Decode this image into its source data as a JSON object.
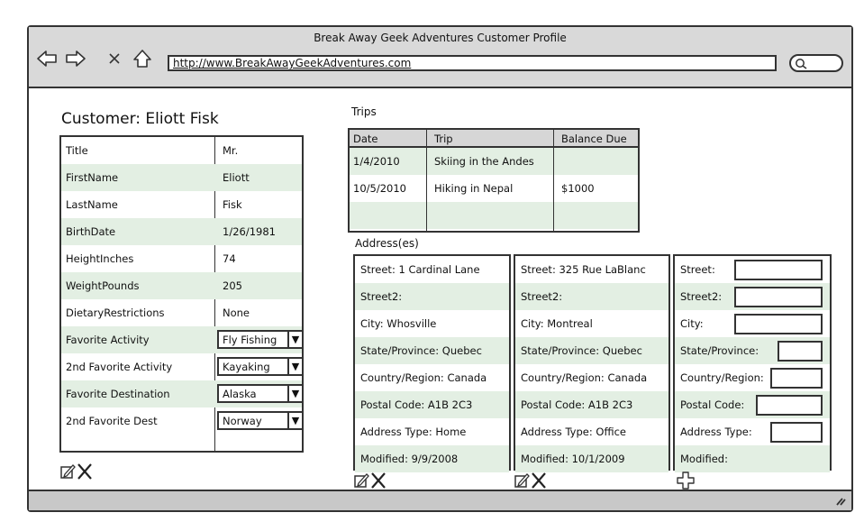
{
  "window": {
    "title": "Break Away Geek Adventures Customer Profile"
  },
  "browser": {
    "url": "http://www.BreakAwayGeekAdventures.com",
    "icons": [
      "back-arrow-icon",
      "forward-arrow-icon",
      "close-icon",
      "home-icon",
      "search-icon"
    ]
  },
  "customer": {
    "heading": "Customer: Eliott Fisk",
    "rows": [
      {
        "label": "Title",
        "value": "Mr."
      },
      {
        "label": "FirstName",
        "value": "Eliott"
      },
      {
        "label": "LastName",
        "value": "Fisk"
      },
      {
        "label": "BirthDate",
        "value": "1/26/1981"
      },
      {
        "label": "HeightInches",
        "value": "74"
      },
      {
        "label": "WeightPounds",
        "value": "205"
      },
      {
        "label": "DietaryRestrictions",
        "value": "None"
      },
      {
        "label": "Favorite Activity",
        "value": "Fly Fishing",
        "type": "select"
      },
      {
        "label": "2nd Favorite Activity",
        "value": "Kayaking",
        "type": "select"
      },
      {
        "label": "Favorite Destination",
        "value": "Alaska",
        "type": "select"
      },
      {
        "label": "2nd Favorite Dest",
        "value": "Norway",
        "type": "select"
      }
    ],
    "dropdown_glyph": "▼"
  },
  "trips": {
    "label": "Trips",
    "columns": [
      "Date",
      "Trip",
      "Balance Due"
    ],
    "rows": [
      [
        "1/4/2010",
        "Skiing in the Andes",
        ""
      ],
      [
        "10/5/2010",
        "Hiking in Nepal",
        "$1000"
      ]
    ]
  },
  "addresses": {
    "label": "Address(es)",
    "records": [
      {
        "street": "Street: 1 Cardinal Lane",
        "street2": "Street2:",
        "city": "City: Whosville",
        "state": "State/Province: Quebec",
        "country": "Country/Region: Canada",
        "postal": "Postal Code: A1B 2C3",
        "type": "Address Type: Home",
        "modified": "Modified: 9/9/2008"
      },
      {
        "street": "Street: 325 Rue LaBlanc",
        "street2": "Street2:",
        "city": "City: Montreal",
        "state": "State/Province: Quebec",
        "country": "Country/Region: Canada",
        "postal": "Postal Code: A1B 2C3",
        "type": "Address Type: Office",
        "modified": "Modified: 10/1/2009"
      }
    ],
    "new_form": {
      "street": "Street:",
      "street2": "Street2:",
      "city": "City:",
      "state": "State/Province:",
      "country": "Country/Region:",
      "postal": "Postal Code:",
      "type": "Address Type:",
      "modified": "Modified:"
    }
  },
  "actions": {
    "edit_icon": "edit-icon",
    "delete_icon": "delete-icon",
    "add_icon": "add-icon"
  }
}
